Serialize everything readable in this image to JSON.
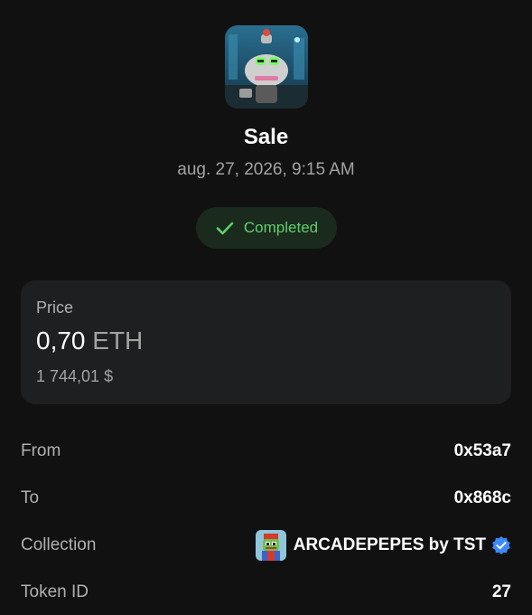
{
  "transaction": {
    "title": "Sale",
    "date": "aug. 27, 2026, 9:15 AM",
    "status": "Completed",
    "thumbnail_icon": "nft-robot-pepe-image"
  },
  "price": {
    "label": "Price",
    "amount": "0,70",
    "unit": "ETH",
    "fiat": "1 744,01 $"
  },
  "details": {
    "from": {
      "label": "From",
      "value": "0x53a7"
    },
    "to": {
      "label": "To",
      "value": "0x868c"
    },
    "collection": {
      "label": "Collection",
      "value": "ARCADEPEPES by TST",
      "avatar_icon": "arcade-pepe-avatar",
      "verified_icon": "verified-badge-icon"
    },
    "token_id": {
      "label": "Token ID",
      "value": "27"
    }
  },
  "colors": {
    "background": "#111111",
    "card": "#1e1f21",
    "status_green": "#5fcf6e",
    "verified_blue": "#3d8bfd"
  }
}
